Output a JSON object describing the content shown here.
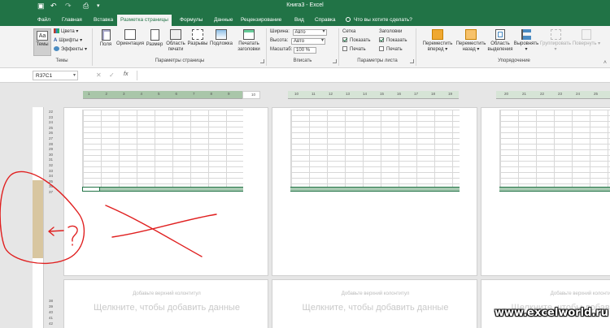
{
  "window": {
    "title": "Книга3  -  Excel"
  },
  "qat": {
    "save_icon": "▣",
    "undo_icon": "↶",
    "redo_icon": "↷",
    "preview_icon": "⎙",
    "more_icon": "▾"
  },
  "tabs": [
    "Файл",
    "Главная",
    "Вставка",
    "Разметка страницы",
    "Формулы",
    "Данные",
    "Рецензирование",
    "Вид",
    "Справка"
  ],
  "tell_me": "Что вы хотите сделать?",
  "ribbon": {
    "themes": {
      "big": "Темы",
      "colors": "Цвета",
      "fonts": "Шрифты",
      "effects": "Эффекты",
      "group": "Темы"
    },
    "page_setup": {
      "buttons": [
        "Поля",
        "Ориентация",
        "Размер",
        "Область печати",
        "Разрывы",
        "Подложка",
        "Печатать заголовки"
      ],
      "group": "Параметры страницы"
    },
    "fit": {
      "width_label": "Ширина:",
      "width_value": "Авто",
      "height_label": "Высота:",
      "height_value": "Авто",
      "scale_label": "Масштаб:",
      "scale_value": "100 %",
      "group": "Вписать"
    },
    "sheet_options": {
      "gridlines": "Сетка",
      "headings": "Заголовки",
      "show": "Показать",
      "print": "Печать",
      "group": "Параметры листа"
    },
    "arrange": {
      "buttons": [
        "Переместить вперед",
        "Переместить назад",
        "Область выделения",
        "Выровнять",
        "Группировать",
        "Повернуть"
      ],
      "group": "Упорядочение"
    }
  },
  "formula_bar": {
    "name_box": "R37C1",
    "cancel": "✕",
    "enter": "✓",
    "fx": "fx"
  },
  "ruler_top": {
    "labels": [
      "1",
      "2",
      "3",
      "4",
      "5",
      "6",
      "7",
      "8",
      "9",
      "10",
      "11",
      "12",
      "13",
      "14",
      "15",
      "16",
      "17",
      "18",
      "19",
      "20",
      "21",
      "22",
      "23",
      "24",
      "25",
      "26",
      "27",
      "28",
      "29"
    ]
  },
  "row_numbers_top": [
    "22",
    "23",
    "24",
    "25",
    "26",
    "27",
    "28",
    "29",
    "30",
    "31",
    "32",
    "33",
    "34",
    "35",
    "36",
    "37"
  ],
  "row_numbers_bottom": [
    "38",
    "39",
    "40",
    "41",
    "42"
  ],
  "header_hint": "Добавьте верхний колонтитул",
  "header_click": "Щелкните, чтобы добавить данные",
  "watermark": "www.excelworld.ru",
  "colors": {
    "brand": "#217346",
    "annotation": "#e02020"
  }
}
